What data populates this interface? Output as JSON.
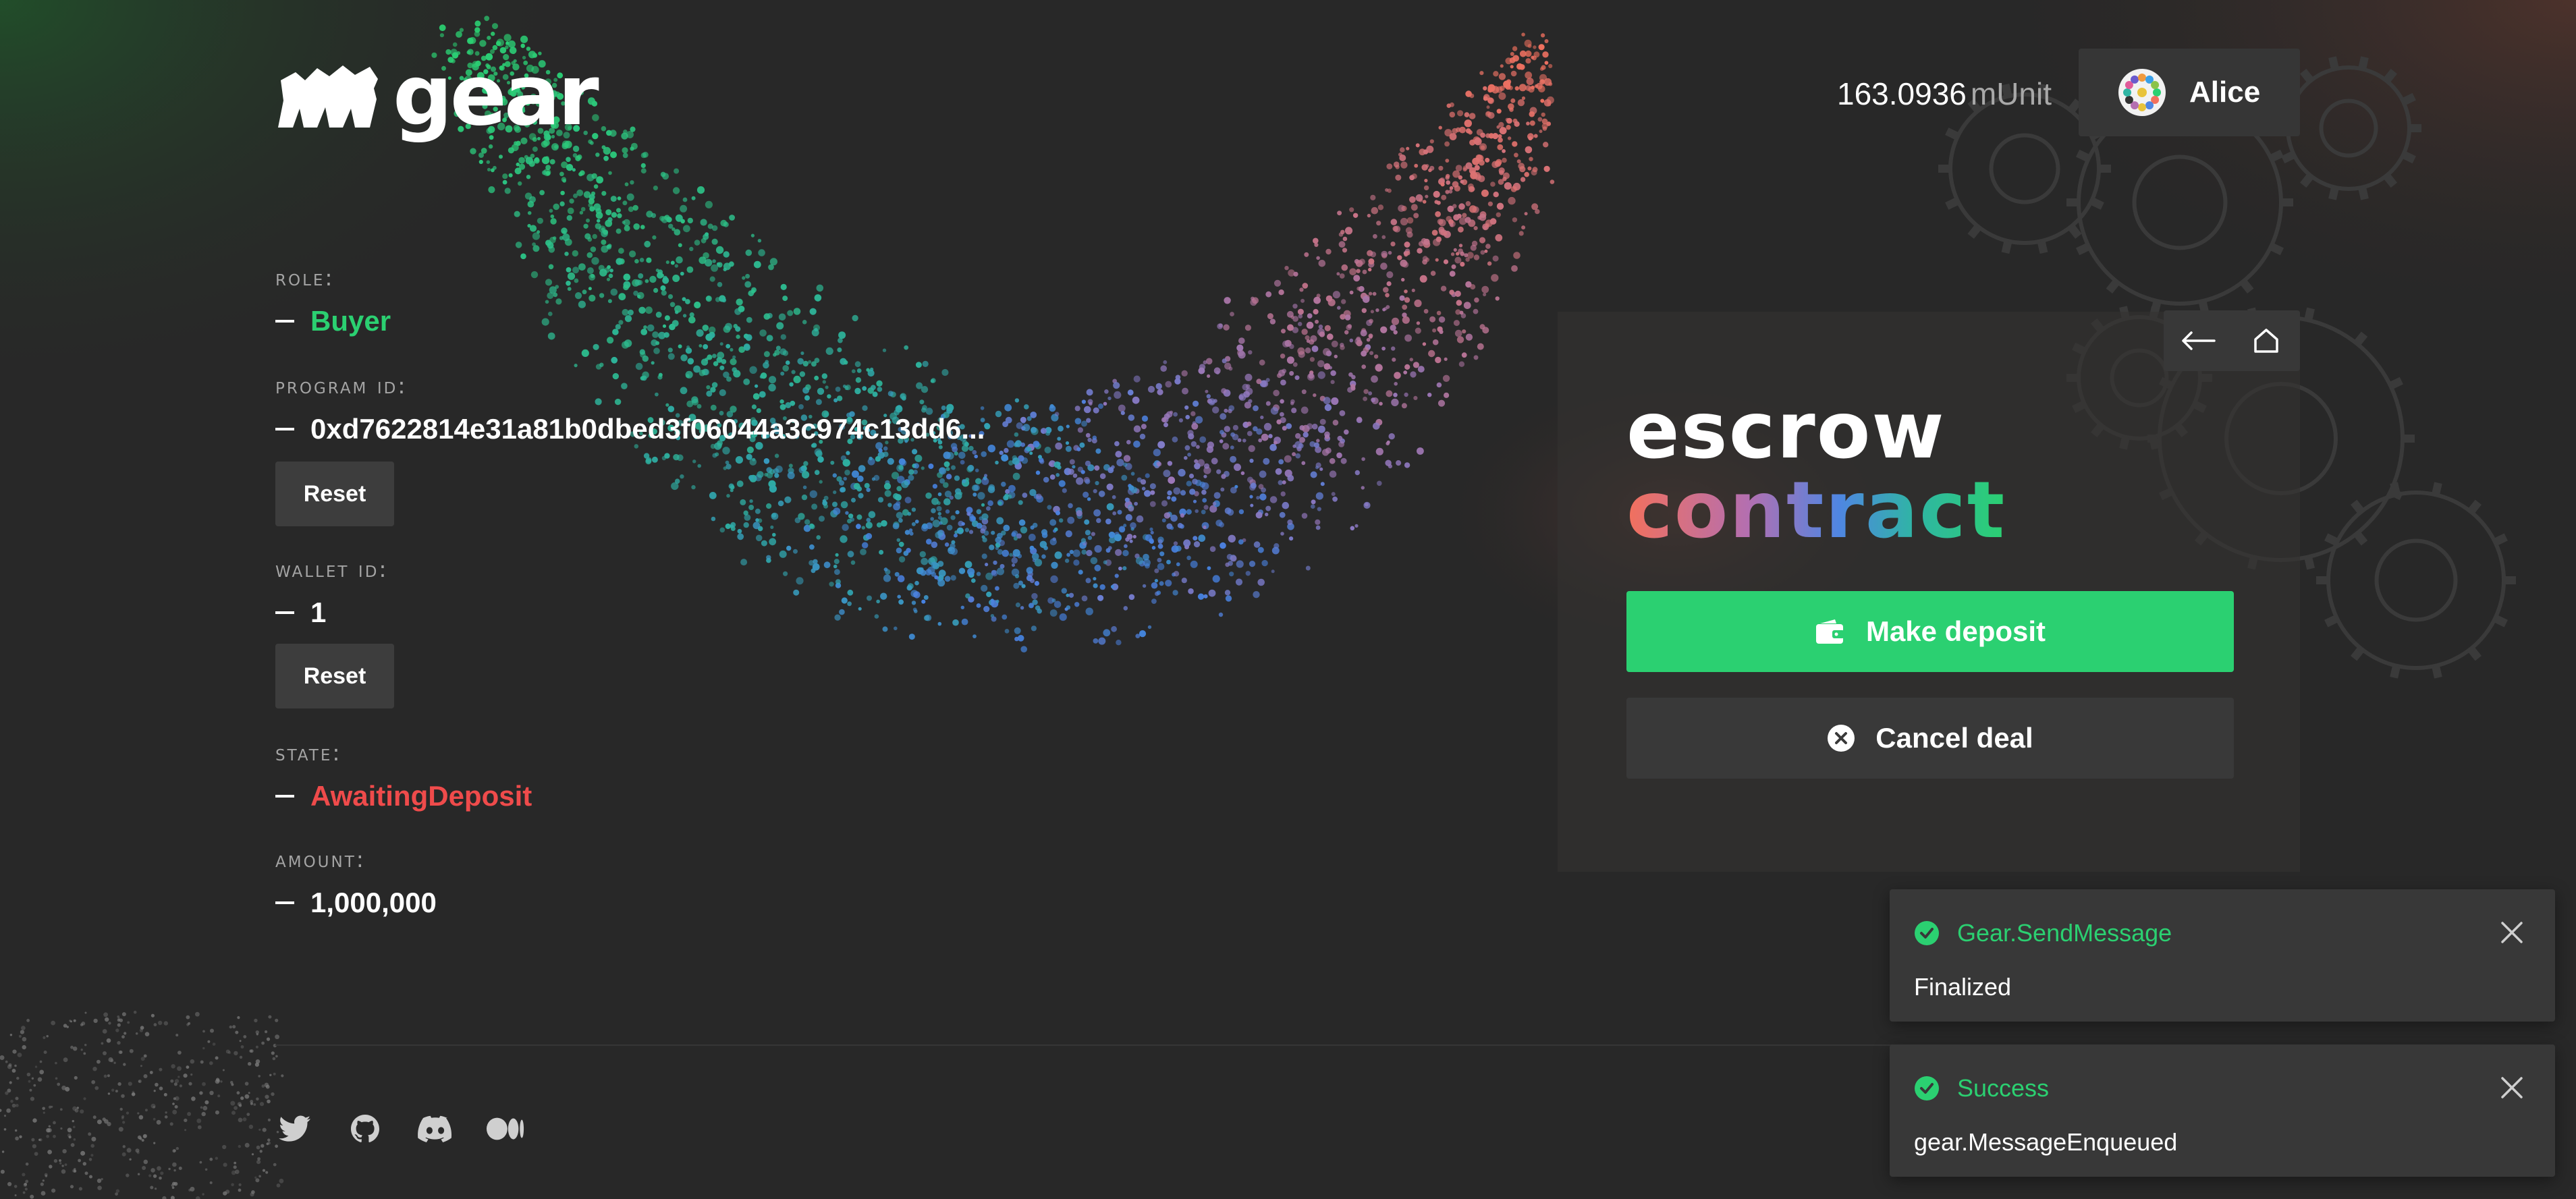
{
  "colors": {
    "accent_green": "#2bd071",
    "state_red": "#ef4b4b",
    "background": "#282828"
  },
  "header": {
    "logo_text": "gear",
    "balance_value": "163.0936",
    "balance_unit": "mUnit",
    "account_name": "Alice"
  },
  "info": {
    "role_label": "Role:",
    "role_value": "Buyer",
    "program_label": "Program ID:",
    "program_value": "0xd7622814e31a81b0dbed3f06044a3c974c13dd6...",
    "program_reset": "Reset",
    "wallet_label": "Wallet ID:",
    "wallet_value": "1",
    "wallet_reset": "Reset",
    "state_label": "State:",
    "state_value": "AwaitingDeposit",
    "amount_label": "Amount:",
    "amount_value": "1,000,000"
  },
  "card": {
    "title_line1": "escrow",
    "title_line2": "contract",
    "back_icon": "arrow-left-icon",
    "home_icon": "home-icon",
    "deposit_label": "Make deposit",
    "cancel_label": "Cancel deal"
  },
  "footer": {
    "social_icons": [
      "twitter-icon",
      "github-icon",
      "discord-icon",
      "medium-icon"
    ]
  },
  "toasts": [
    {
      "title": "Gear.SendMessage",
      "text": "Finalized"
    },
    {
      "title": "Success",
      "text": "gear.MessageEnqueued"
    }
  ]
}
